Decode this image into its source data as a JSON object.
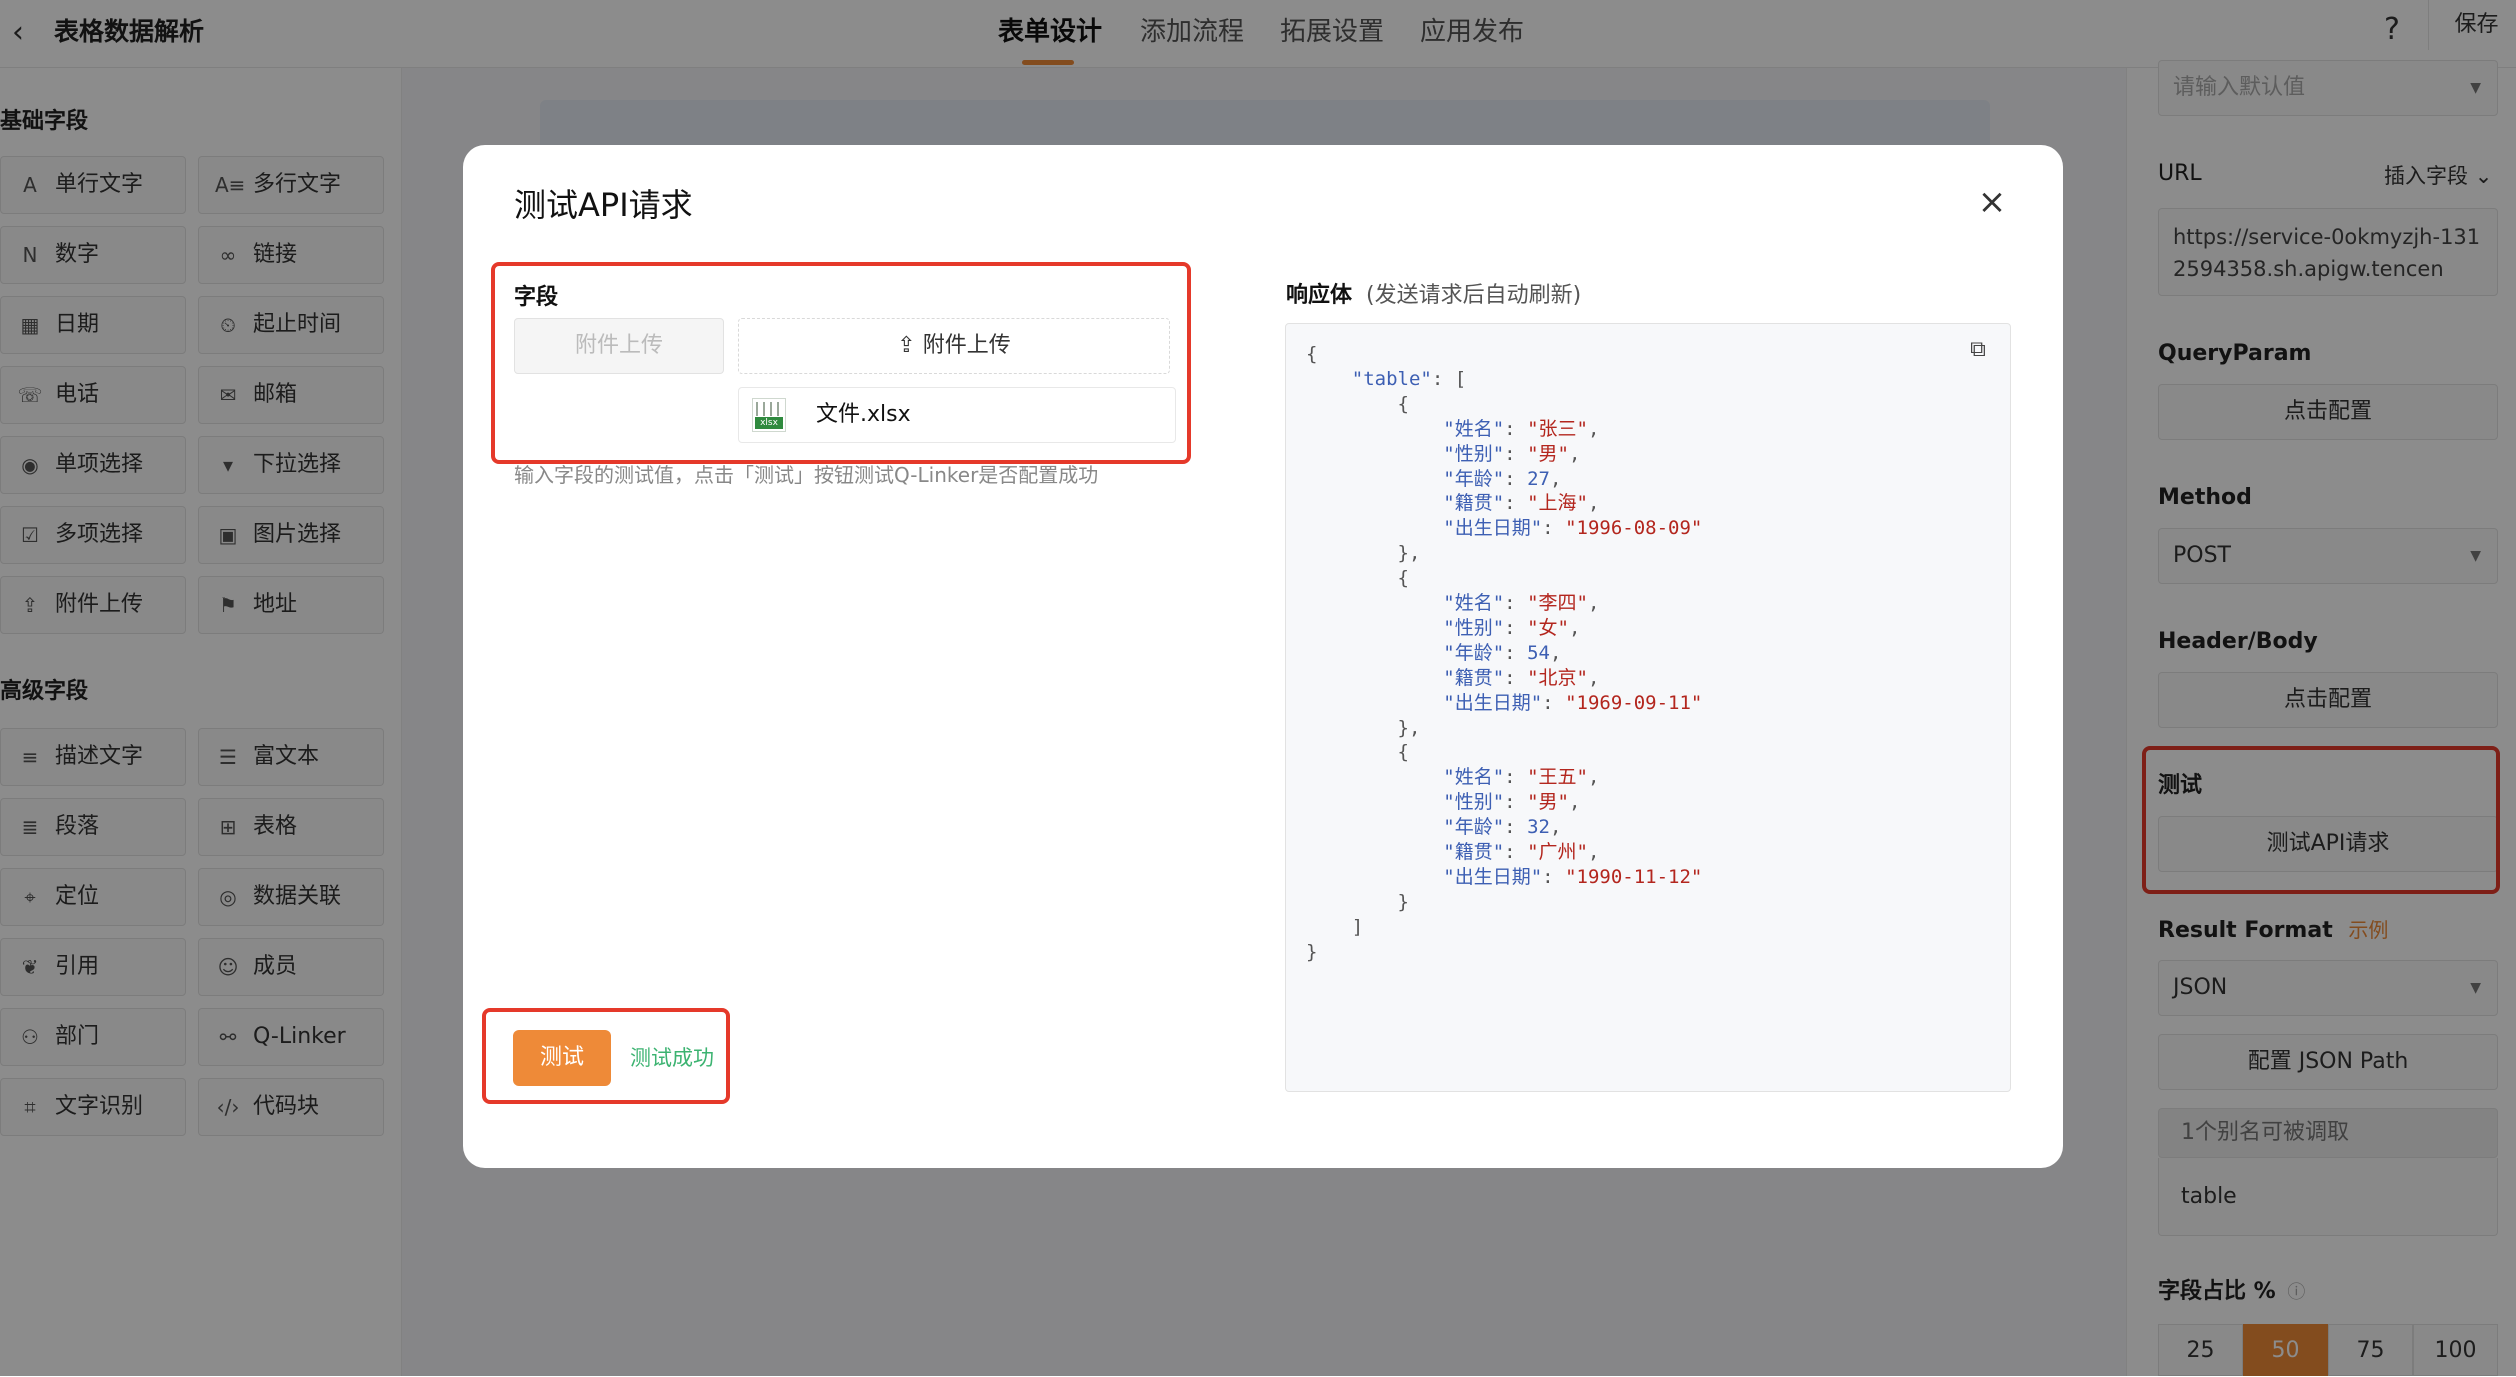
{
  "header": {
    "back_icon": "‹",
    "title": "表格数据解析",
    "tabs": [
      {
        "label": "表单设计",
        "active": true
      },
      {
        "label": "添加流程",
        "active": false
      },
      {
        "label": "拓展设置",
        "active": false
      },
      {
        "label": "应用发布",
        "active": false
      }
    ],
    "help": "?",
    "save": "保存"
  },
  "sidebar": {
    "basic_title": "基础字段",
    "basic": [
      {
        "icon": "A",
        "label": "单行文字"
      },
      {
        "icon": "A≡",
        "label": "多行文字"
      },
      {
        "icon": "N",
        "label": "数字"
      },
      {
        "icon": "∞",
        "label": "链接"
      },
      {
        "icon": "▦",
        "label": "日期"
      },
      {
        "icon": "⏲",
        "label": "起止时间"
      },
      {
        "icon": "☏",
        "label": "电话"
      },
      {
        "icon": "✉",
        "label": "邮箱"
      },
      {
        "icon": "◉",
        "label": "单项选择"
      },
      {
        "icon": "▾",
        "label": "下拉选择"
      },
      {
        "icon": "☑",
        "label": "多项选择"
      },
      {
        "icon": "▣",
        "label": "图片选择"
      },
      {
        "icon": "⇪",
        "label": "附件上传"
      },
      {
        "icon": "⚑",
        "label": "地址"
      }
    ],
    "advanced_title": "高级字段",
    "advanced": [
      {
        "icon": "≡",
        "label": "描述文字"
      },
      {
        "icon": "☰",
        "label": "富文本"
      },
      {
        "icon": "≣",
        "label": "段落"
      },
      {
        "icon": "⊞",
        "label": "表格"
      },
      {
        "icon": "⌖",
        "label": "定位"
      },
      {
        "icon": "◎",
        "label": "数据关联"
      },
      {
        "icon": "❦",
        "label": "引用"
      },
      {
        "icon": "☺",
        "label": "成员"
      },
      {
        "icon": "⚇",
        "label": "部门"
      },
      {
        "icon": "⚯",
        "label": "Q-Linker"
      },
      {
        "icon": "⌗",
        "label": "文字识别"
      },
      {
        "icon": "‹/›",
        "label": "代码块"
      }
    ]
  },
  "right_panel": {
    "default_placeholder": "请输入默认值",
    "url_label": "URL",
    "insert_field": "插入字段",
    "url_value": "https://service-0okmyzjh-1312594358.sh.apigw.tencen",
    "query_label": "QueryParam",
    "query_btn": "点击配置",
    "method_label": "Method",
    "method_value": "POST",
    "header_label": "Header/Body",
    "header_btn": "点击配置",
    "test_label": "测试",
    "test_btn": "测试API请求",
    "result_format_label": "Result Format",
    "result_example": "示例",
    "result_value": "JSON",
    "json_path_btn": "配置 JSON Path",
    "alias_note": "1个别名可被调取",
    "alias_value": "table",
    "ratio_label": "字段占比 %",
    "ratios": [
      "25",
      "50",
      "75",
      "100"
    ],
    "ratio_selected": "50"
  },
  "modal": {
    "title": "测试API请求",
    "close": "×",
    "field_label": "字段",
    "upload_disabled": "附件上传",
    "upload_btn": "⇪ 附件上传",
    "file_name": "文件.xlsx",
    "xlsx_tag": "xlsx",
    "hint": "输入字段的测试值，点击「测试」按钮测试Q-Linker是否配置成功",
    "response_label": "响应体",
    "response_sub": "(发送请求后自动刷新)",
    "test_btn": "测试",
    "test_success": "测试成功",
    "response_json": {
      "table": [
        {
          "姓名": "张三",
          "性别": "男",
          "年龄": 27,
          "籍贯": "上海",
          "出生日期": "1996-08-09"
        },
        {
          "姓名": "李四",
          "性别": "女",
          "年龄": 54,
          "籍贯": "北京",
          "出生日期": "1969-09-11"
        },
        {
          "姓名": "王五",
          "性别": "男",
          "年龄": 32,
          "籍贯": "广州",
          "出生日期": "1990-11-12"
        }
      ]
    }
  },
  "colors": {
    "accent": "#ee8a38",
    "highlight": "#e5392a",
    "success": "#3cb371"
  }
}
